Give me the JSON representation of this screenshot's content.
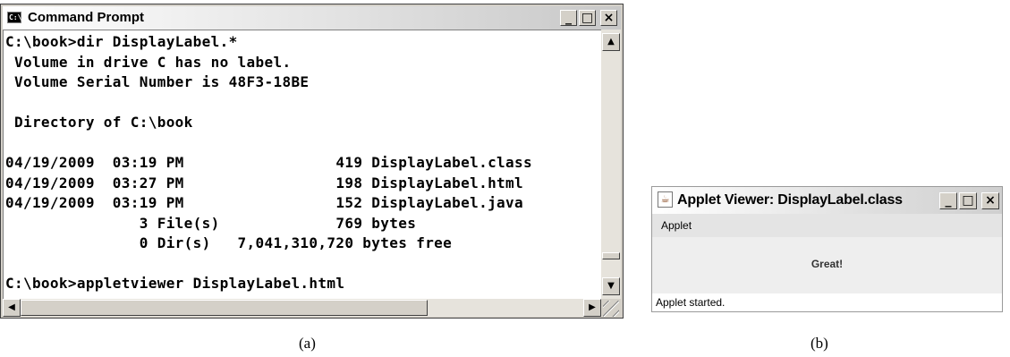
{
  "cmd_window": {
    "title": "Command Prompt",
    "icon": "cmd-icon",
    "icon_text": "C:\\",
    "minimize_label": "_",
    "maximize_label": "□",
    "close_label": "×",
    "console_lines": [
      "C:\\book>dir DisplayLabel.*",
      " Volume in drive C has no label.",
      " Volume Serial Number is 48F3-18BE",
      "",
      " Directory of C:\\book",
      "",
      "04/19/2009  03:19 PM                 419 DisplayLabel.class",
      "04/19/2009  03:27 PM                 198 DisplayLabel.html",
      "04/19/2009  03:19 PM                 152 DisplayLabel.java",
      "               3 File(s)             769 bytes",
      "               0 Dir(s)   7,041,310,720 bytes free",
      "",
      "C:\\book>appletviewer DisplayLabel.html"
    ],
    "scroll_up_label": "▲",
    "scroll_down_label": "▼",
    "scroll_left_label": "◀",
    "scroll_right_label": "▶"
  },
  "applet_window": {
    "title": "Applet Viewer: DisplayLabel.class",
    "icon": "java-coffee-icon",
    "icon_glyph": "☕",
    "minimize_label": "_",
    "maximize_label": "□",
    "close_label": "×",
    "menu": "Applet",
    "label_text": "Great!",
    "status": "Applet started."
  },
  "captions": {
    "a": "(a)",
    "b": "(b)"
  }
}
